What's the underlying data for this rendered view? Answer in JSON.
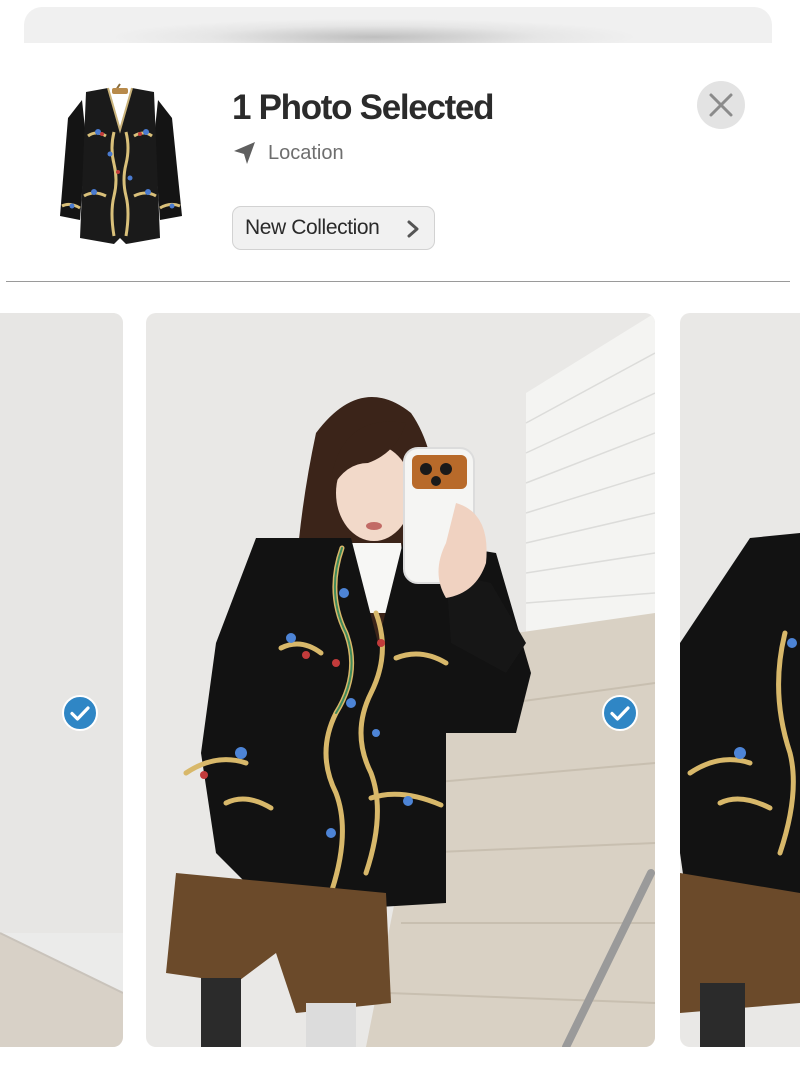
{
  "header": {
    "title": "1 Photo Selected",
    "location_label": "Location",
    "collection_label": "New Collection",
    "location_icon": "navigation-arrow-icon",
    "close_icon": "close-icon",
    "collection_icon": "chevron-right-icon"
  },
  "photos": {
    "left": {
      "selected": true,
      "icon": "checkmark-circle-icon"
    },
    "main": {
      "selected": true,
      "icon": "checkmark-circle-icon"
    },
    "right": {
      "selected": false
    }
  },
  "colors": {
    "accent": "#2f86c5",
    "title": "#2b2b2b",
    "secondary_text": "#6e6e6e"
  }
}
